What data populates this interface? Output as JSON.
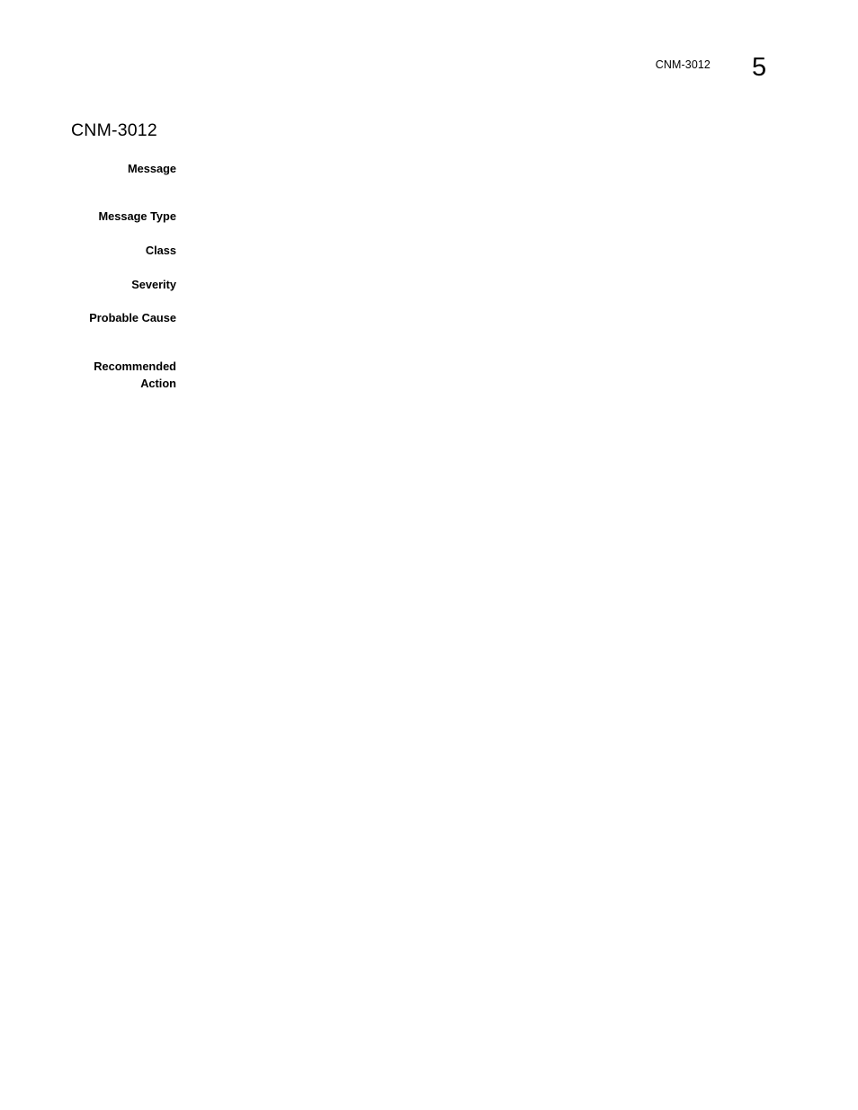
{
  "page": {
    "header": {
      "running_title": "CNM-3012",
      "page_number": "5"
    },
    "section_title": "CNM-3012",
    "fields": [
      {
        "label": "Message",
        "value": ""
      },
      {
        "label": "Message Type",
        "value": ""
      },
      {
        "label": "Class",
        "value": ""
      },
      {
        "label": "Severity",
        "value": ""
      },
      {
        "label": "Probable Cause",
        "value": ""
      },
      {
        "label": "Recommended Action",
        "label_line1": "Recommended",
        "label_line2": "Action",
        "value": ""
      }
    ]
  }
}
